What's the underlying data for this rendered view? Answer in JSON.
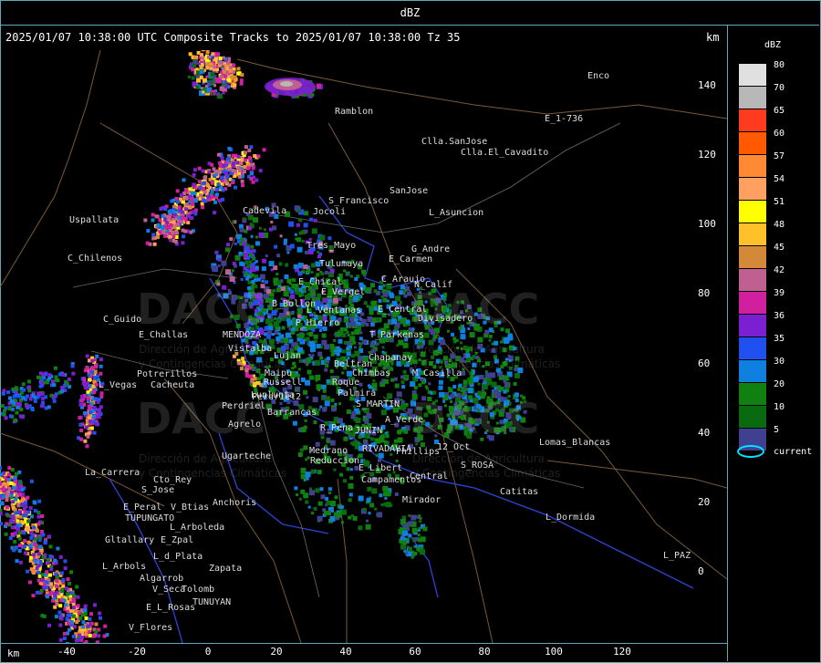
{
  "window": {
    "title": "dBZ"
  },
  "header": {
    "text": "2025/01/07 10:38:00 UTC Composite Tracks to 2025/01/07 10:38:00 Tz 35",
    "unit_top": "km",
    "unit_bottom": "km"
  },
  "axes": {
    "x_ticks": [
      "-40",
      "-20",
      "0",
      "20",
      "40",
      "60",
      "80",
      "100",
      "120"
    ],
    "y_ticks": [
      "140",
      "120",
      "100",
      "80",
      "60",
      "40",
      "20",
      "0"
    ]
  },
  "watermark": {
    "name": "DACC",
    "line1": "Dirección de Agricultura",
    "line2": "y Contingencias Climáticas"
  },
  "places": [
    "Ramblon",
    "Enco",
    "E_1-736",
    "Clla.SanJose",
    "Clla.El_Cavadito",
    "Uspallata",
    "S_Francisco",
    "SanJose",
    "L_Asuncion",
    "Cadevila",
    "Jocoli",
    "C_Chilenos",
    "Tres_Mayo",
    "G_Andre",
    "Tulumaya",
    "E_Carmen",
    "E_Chical",
    "C_Araujo",
    "N_Calif",
    "E_Vergel",
    "B_Bollon",
    "L_Ventanas",
    "E_Central",
    "Divisadero",
    "C_Guido",
    "P_Hierro",
    "T_Parkenas",
    "E_Challas",
    "MENDOZA",
    "Chapanay",
    "Beltran",
    "Chimbas",
    "M_Casilla",
    "Potrerillos",
    "Cacheuta",
    "L_Vegas",
    "Roque",
    "Perdriel",
    "S_MARTIN",
    "Palmira",
    "A_Verde",
    "Agrelo",
    "R_Pena",
    "JUNIN",
    "Lomas_Blancas",
    "Ugarteche",
    "RIVADAVIA",
    "Phillips",
    "12_Oct",
    "Medrano",
    "Reduccion",
    "E_Libert",
    "S_ROSA",
    "Campamentos",
    "La_Carrera",
    "Cto_Rey",
    "Central",
    "S_Jose",
    "Catitas",
    "Anchoris",
    "Mirador",
    "E_Peral",
    "V_Btias",
    "TUPUNGATO",
    "L_Arboleda",
    "L_Dormida",
    "Gltallary",
    "E_Zpal",
    "L_d_Plata",
    "L_Arbols",
    "Zapata",
    "L_PAZ",
    "Algarrob",
    "V_Seca",
    "Tolomb",
    "E_L_Rosas",
    "TUNUYAN",
    "V_Flores",
    "Vistalba",
    "Lujan",
    "Russell",
    "Maipu",
    "Lunlunta",
    "Barrancas",
    "Perdriel2"
  ],
  "legend": {
    "title": "dBZ",
    "items": [
      {
        "value": "80",
        "color": "#e0e0e0"
      },
      {
        "value": "70",
        "color": "#b8b8b8"
      },
      {
        "value": "65",
        "color": "#ff3b1f"
      },
      {
        "value": "60",
        "color": "#ff5a00"
      },
      {
        "value": "57",
        "color": "#ff8a33"
      },
      {
        "value": "54",
        "color": "#ffa060"
      },
      {
        "value": "51",
        "color": "#ffff00"
      },
      {
        "value": "48",
        "color": "#ffc02a"
      },
      {
        "value": "45",
        "color": "#d4883a"
      },
      {
        "value": "42",
        "color": "#c06090"
      },
      {
        "value": "39",
        "color": "#d020a0"
      },
      {
        "value": "36",
        "color": "#7a20d0"
      },
      {
        "value": "35",
        "color": "#2050f0"
      },
      {
        "value": "30",
        "color": "#1080e0"
      },
      {
        "value": "20",
        "color": "#108010"
      },
      {
        "value": "10",
        "color": "#0a6a10"
      },
      {
        "value": "5",
        "color": "#404090"
      }
    ],
    "current_label": "current",
    "current_color": "#00e5ff"
  }
}
